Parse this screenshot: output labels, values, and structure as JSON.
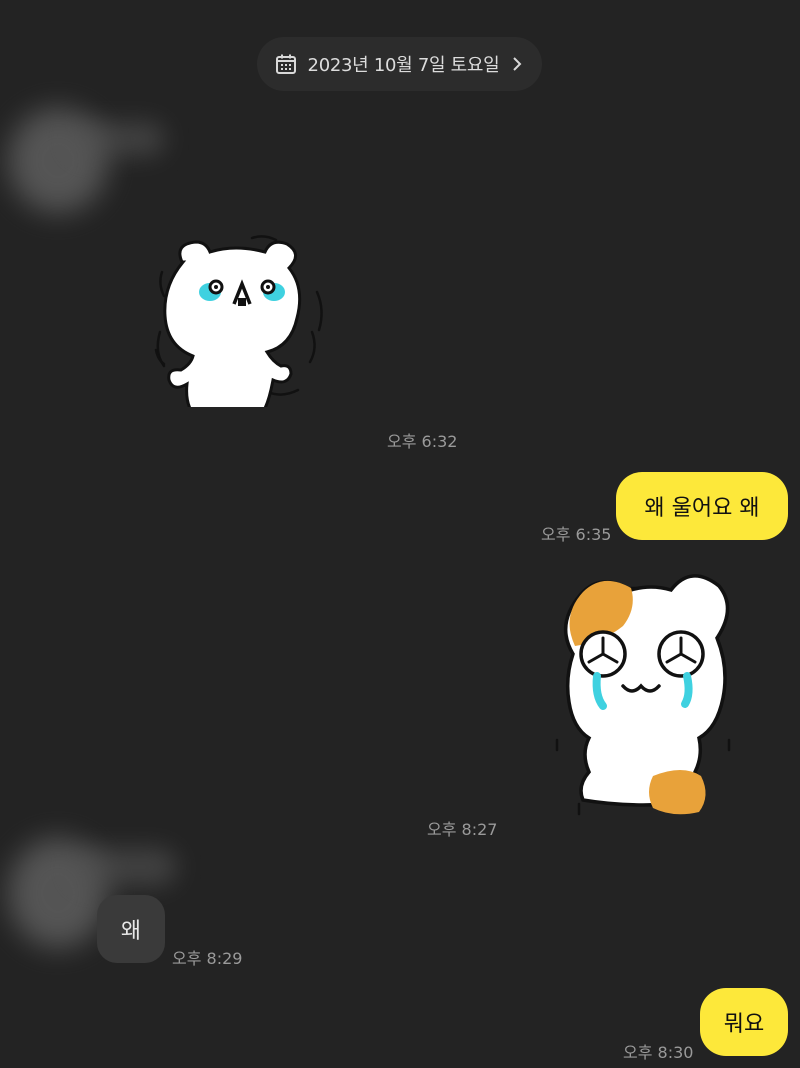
{
  "date_header": {
    "label": "2023년 10월 7일 토요일",
    "icon": "calendar-icon",
    "chevron": "chevron-right-icon"
  },
  "messages": [
    {
      "sender": "other",
      "type": "sticker",
      "sticker": "crying-white-bear-sticker",
      "time": "오후 6:32"
    },
    {
      "sender": "me",
      "type": "text",
      "text": "왜 울어요 왜",
      "time": "오후 6:35"
    },
    {
      "sender": "me",
      "type": "sticker",
      "sticker": "crying-calico-hamster-sticker",
      "time": "오후 8:27"
    },
    {
      "sender": "other",
      "type": "text",
      "text": "왜",
      "time": "오후 8:29"
    },
    {
      "sender": "me",
      "type": "text",
      "text": "뭐요",
      "time": "오후 8:30"
    }
  ],
  "colors": {
    "background": "#232323",
    "my_bubble": "#fde83a",
    "their_bubble": "#3a3a3a",
    "tears": "#3fd1e0",
    "hamster_patch": "#e8a23a"
  }
}
